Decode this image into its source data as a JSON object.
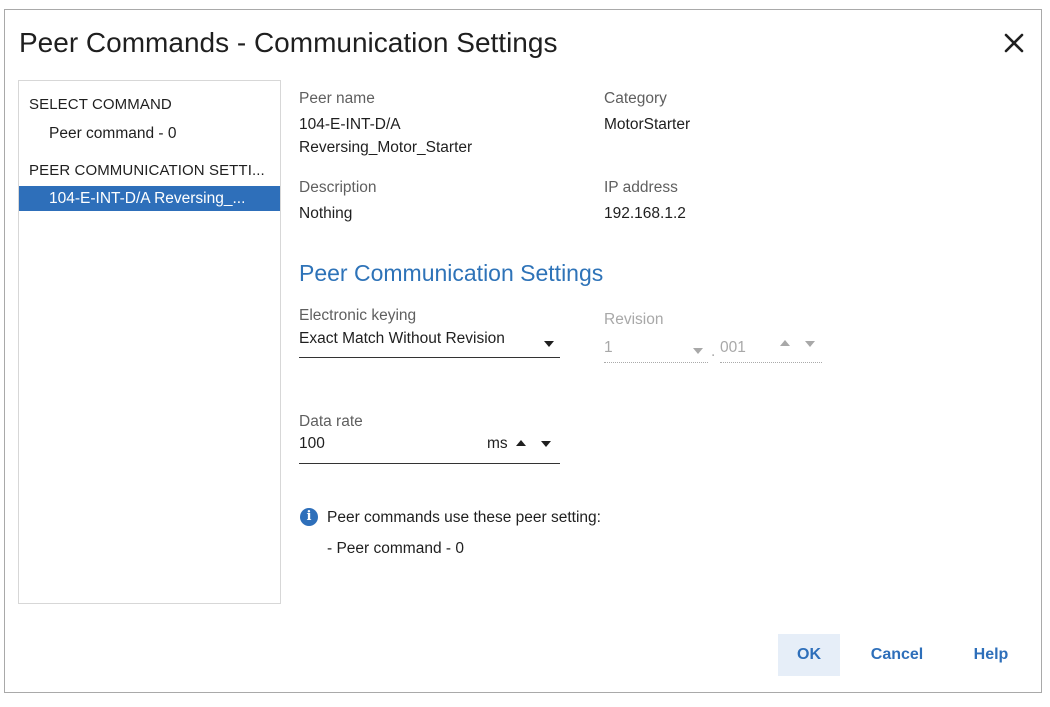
{
  "dialog": {
    "title": "Peer Commands - Communication Settings",
    "close_icon": "close-icon"
  },
  "sidebar": {
    "section1": "SELECT COMMAND",
    "section1_items": [
      "Peer command - 0"
    ],
    "section2": "PEER COMMUNICATION SETTI...",
    "section2_items": [
      "104-E-INT-D/A Reversing_..."
    ]
  },
  "details": {
    "peer_name_label": "Peer name",
    "peer_name_line1": "104-E-INT-D/A",
    "peer_name_line2": "Reversing_Motor_Starter",
    "category_label": "Category",
    "category_value": "MotorStarter",
    "description_label": "Description",
    "description_value": "Nothing",
    "ip_label": "IP address",
    "ip_value": "192.168.1.2"
  },
  "settings": {
    "heading": "Peer Communication Settings",
    "keying_label": "Electronic keying",
    "keying_value": "Exact Match Without Revision",
    "revision_label": "Revision",
    "revision_major": "1",
    "revision_sep": ".",
    "revision_minor": "001",
    "data_rate_label": "Data rate",
    "data_rate_value": "100",
    "data_rate_unit": "ms"
  },
  "info": {
    "message": "Peer commands use these peer setting:",
    "list": [
      "- Peer command - 0"
    ]
  },
  "buttons": {
    "ok": "OK",
    "cancel": "Cancel",
    "help": "Help"
  },
  "colors": {
    "accent": "#2e6fba",
    "heading": "#2e73b8",
    "selected_bg": "#2e6fba",
    "ok_bg": "#e6eef8"
  }
}
